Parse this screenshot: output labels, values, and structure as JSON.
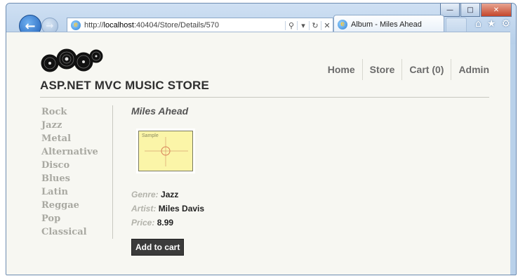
{
  "browser": {
    "url_prefix": "http://",
    "url_host": "localhost",
    "url_rest": ":40404/Store/Details/570",
    "tab_title": "Album - Miles Ahead",
    "window_controls": [
      "minimize-icon",
      "maximize-icon",
      "close-icon"
    ],
    "toolbar_icons": [
      "home-icon",
      "favorites-star-icon",
      "gear-icon"
    ]
  },
  "site": {
    "title": "ASP.NET MVC MUSIC STORE",
    "nav": [
      "Home",
      "Store",
      "Cart (0)",
      "Admin"
    ]
  },
  "genres": [
    "Rock",
    "Jazz",
    "Metal",
    "Alternative",
    "Disco",
    "Blues",
    "Latin",
    "Reggae",
    "Pop",
    "Classical"
  ],
  "album": {
    "title": "Miles Ahead",
    "cover_text": "Sample",
    "genre_label": "Genre:",
    "genre": "Jazz",
    "artist_label": "Artist:",
    "artist": "Miles Davis",
    "price_label": "Price:",
    "price": "8.99",
    "add_button": "Add to cart"
  }
}
